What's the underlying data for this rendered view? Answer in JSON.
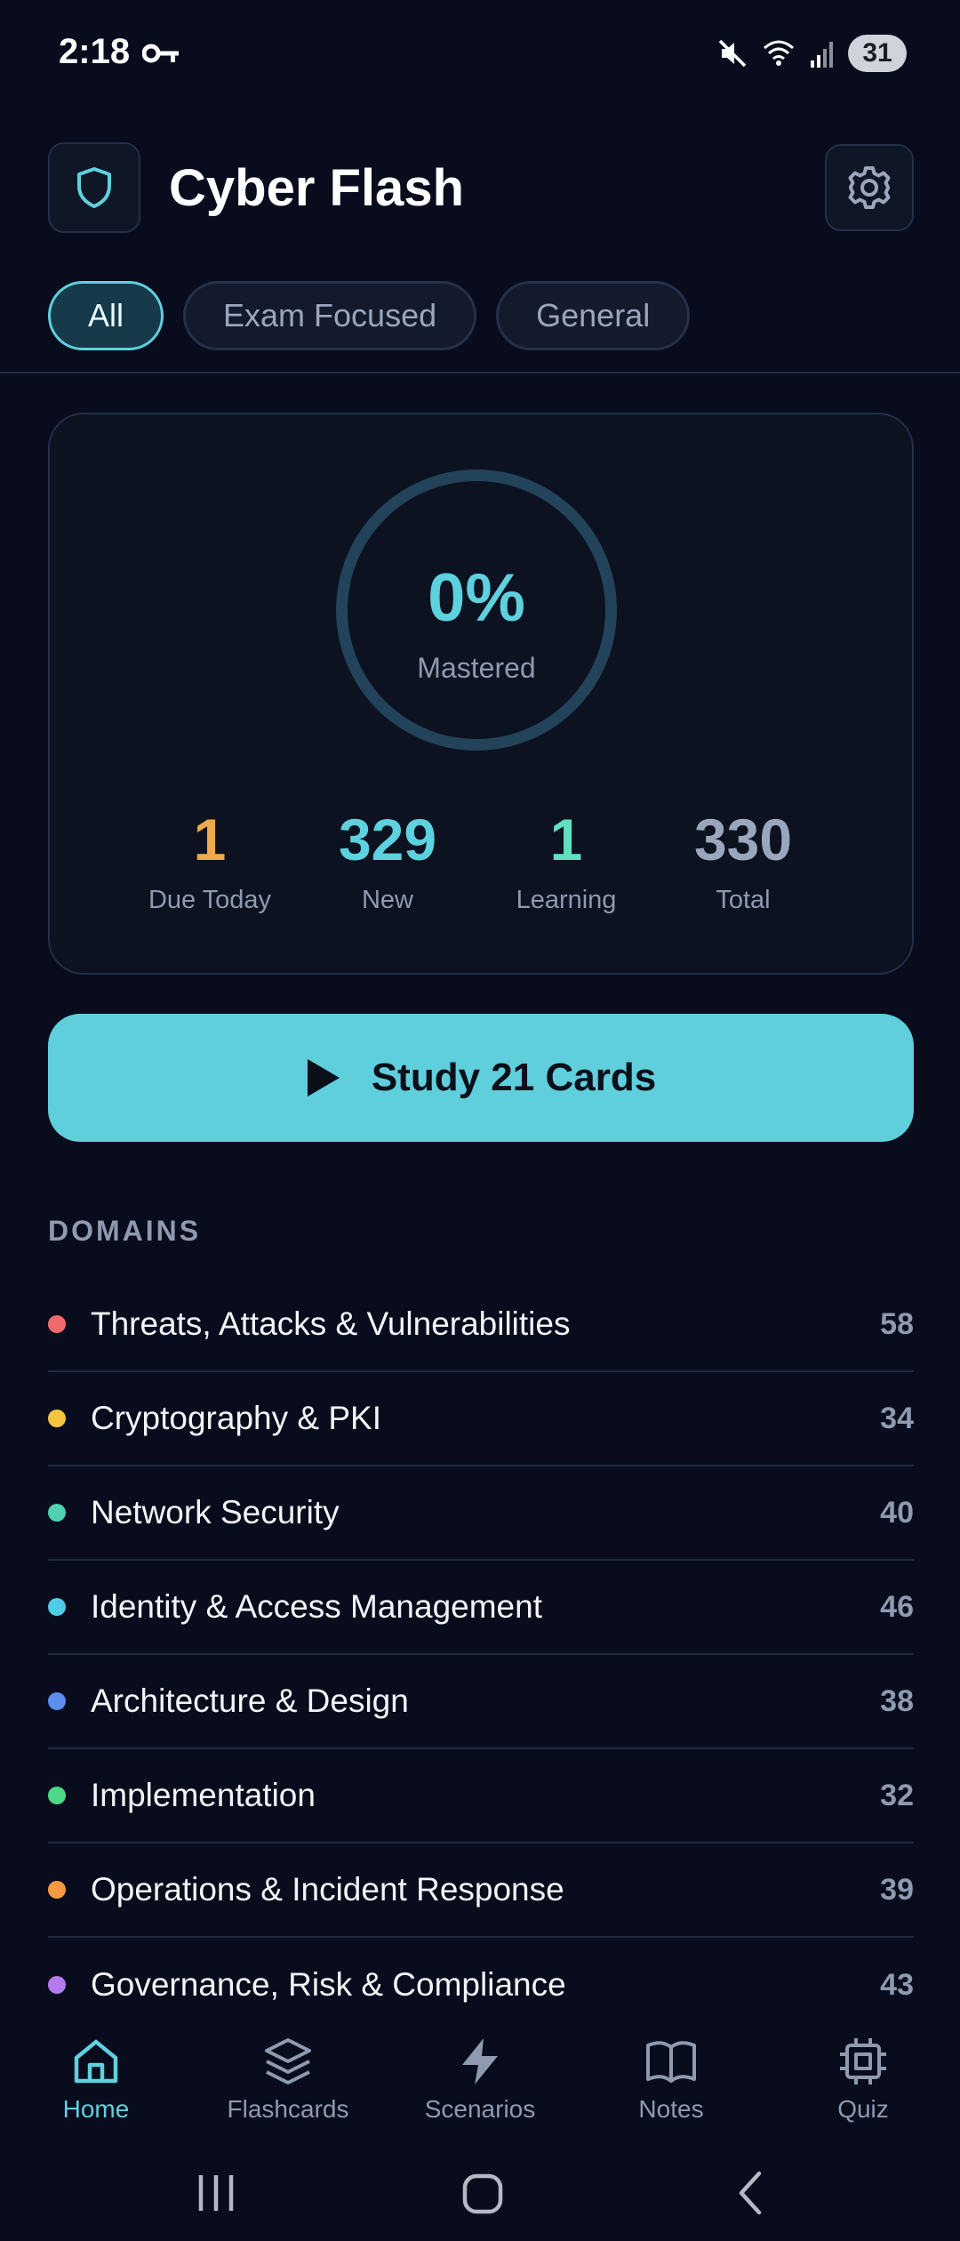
{
  "status_bar": {
    "time": "2:18",
    "battery": "31"
  },
  "header": {
    "title": "Cyber Flash"
  },
  "tabs": [
    {
      "label": "All",
      "active": true
    },
    {
      "label": "Exam Focused",
      "active": false
    },
    {
      "label": "General",
      "active": false
    }
  ],
  "stats": {
    "mastered_percent": "0%",
    "mastered_label": "Mastered",
    "items": [
      {
        "value": "1",
        "label": "Due Today",
        "color": "#f0a948"
      },
      {
        "value": "329",
        "label": "New",
        "color": "#5ed1de"
      },
      {
        "value": "1",
        "label": "Learning",
        "color": "#5fe0c0"
      },
      {
        "value": "330",
        "label": "Total",
        "color": "#9aa6bc"
      }
    ]
  },
  "study_button": {
    "label": "Study 21 Cards"
  },
  "domains": {
    "heading": "DOMAINS",
    "items": [
      {
        "name": "Threats, Attacks & Vulnerabilities",
        "count": "58",
        "color": "#ef6b6b"
      },
      {
        "name": "Cryptography & PKI",
        "count": "34",
        "color": "#f5c542"
      },
      {
        "name": "Network Security",
        "count": "40",
        "color": "#4fd1b0"
      },
      {
        "name": "Identity & Access Management",
        "count": "46",
        "color": "#4fcde6"
      },
      {
        "name": "Architecture & Design",
        "count": "38",
        "color": "#5b8def"
      },
      {
        "name": "Implementation",
        "count": "32",
        "color": "#4cd884"
      },
      {
        "name": "Operations & Incident Response",
        "count": "39",
        "color": "#f59a42"
      },
      {
        "name": "Governance, Risk & Compliance",
        "count": "43",
        "color": "#b57af0"
      }
    ]
  },
  "bottom_nav": [
    {
      "label": "Home",
      "icon": "home-icon",
      "active": true
    },
    {
      "label": "Flashcards",
      "icon": "layers-icon",
      "active": false
    },
    {
      "label": "Scenarios",
      "icon": "lightning-icon",
      "active": false
    },
    {
      "label": "Notes",
      "icon": "book-icon",
      "active": false
    },
    {
      "label": "Quiz",
      "icon": "chip-icon",
      "active": false
    }
  ],
  "colors": {
    "accent": "#5ed1de",
    "background": "#080c1c",
    "muted": "#8e9ab0"
  }
}
